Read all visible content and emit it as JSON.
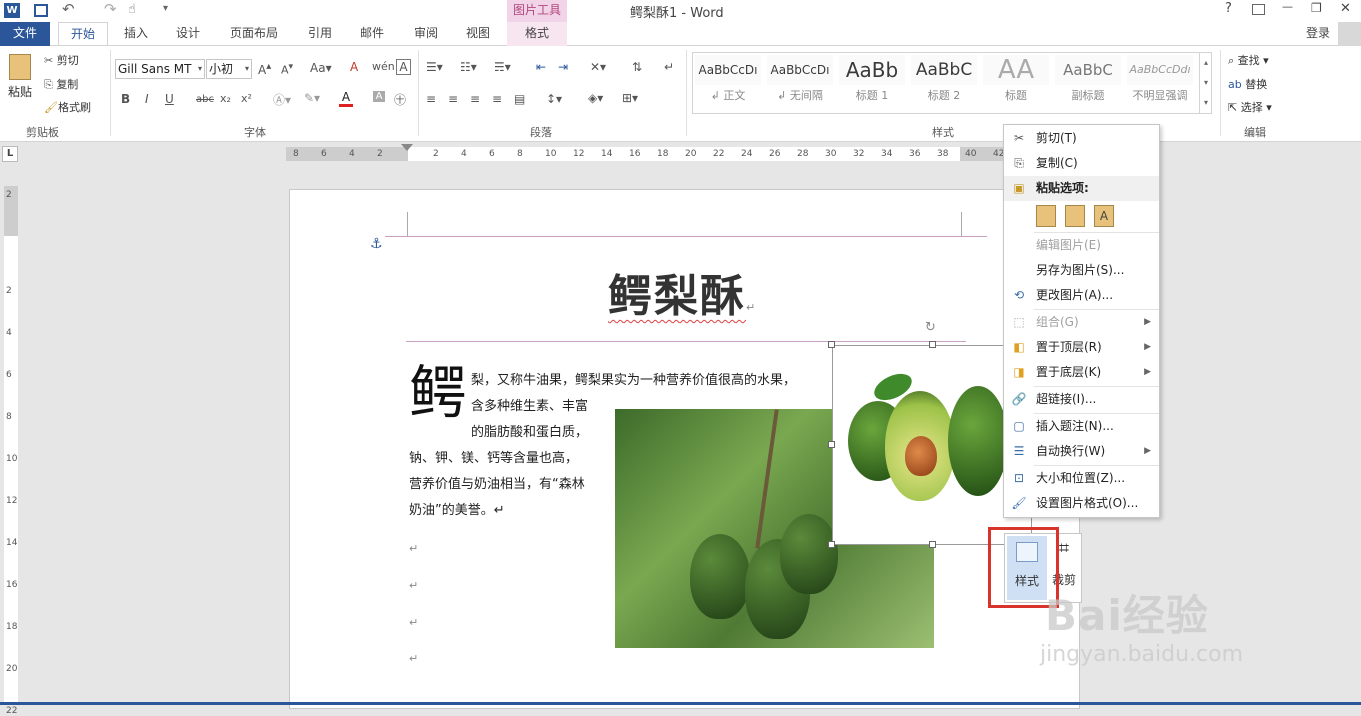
{
  "titlebar": {
    "doc_title": "鳄梨酥1 - Word",
    "picture_tools": "图片工具",
    "help": "?",
    "minimize": "—",
    "restore": "❐",
    "close": "✕",
    "quick": {
      "undo": "↶",
      "redo": "↷"
    }
  },
  "tabs": {
    "file": "文件",
    "home": "开始",
    "insert": "插入",
    "design": "设计",
    "layout": "页面布局",
    "references": "引用",
    "mailings": "邮件",
    "review": "审阅",
    "view": "视图",
    "format": "格式",
    "login": "登录"
  },
  "clipboard": {
    "paste": "粘贴",
    "cut": "剪切",
    "copy": "复制",
    "painter": "格式刷",
    "group": "剪贴板"
  },
  "font": {
    "name": "Gill Sans MT",
    "size": "小初",
    "group": "字体",
    "bold": "B",
    "italic": "I",
    "underline": "U",
    "strike": "abc",
    "sub": "x₂",
    "sup": "x²"
  },
  "paragraph": {
    "group": "段落"
  },
  "styles": {
    "group": "样式",
    "items": [
      {
        "preview": "AaBbCcDı",
        "label": "↲ 正文"
      },
      {
        "preview": "AaBbCcDı",
        "label": "↲ 无间隔"
      },
      {
        "preview": "AaBb",
        "label": "标题 1"
      },
      {
        "preview": "AaBbC",
        "label": "标题 2"
      },
      {
        "preview": "AA",
        "label": "标题"
      },
      {
        "preview": "AaBbC",
        "label": "副标题"
      },
      {
        "preview": "AaBbCcDdı",
        "label": "不明显强调"
      }
    ]
  },
  "editing": {
    "find": "查找",
    "replace": "替换",
    "select": "选择",
    "group": "编辑"
  },
  "ruler": {
    "ticks": [
      "8",
      "6",
      "4",
      "2",
      "2",
      "4",
      "6",
      "8",
      "10",
      "12",
      "14",
      "16",
      "18",
      "20",
      "22",
      "24",
      "26",
      "28",
      "30",
      "32",
      "34",
      "36",
      "38",
      "40",
      "42"
    ],
    "v_ticks": [
      "2",
      "2",
      "4",
      "6",
      "8",
      "10",
      "12",
      "14",
      "16",
      "18",
      "20",
      "22"
    ]
  },
  "document": {
    "title": "鳄梨酥",
    "dropcap": "鳄",
    "lines": [
      "梨，又称牛油果，鳄梨果实为一种营养价值很高的水果，",
      "含多种维生素、丰富",
      "的脂肪酸和蛋白质，",
      "钠、钾、镁、钙等含量也高，",
      "营养价值与奶油相当，有“森林",
      "奶油”的美誉。↵"
    ],
    "para_mark": "↵"
  },
  "context_menu": {
    "cut": "剪切(T)",
    "copy": "复制(C)",
    "paste_options": "粘贴选项:",
    "edit_picture": "编辑图片(E)",
    "save_as": "另存为图片(S)...",
    "change": "更改图片(A)...",
    "group": "组合(G)",
    "bring_front": "置于顶层(R)",
    "send_back": "置于底层(K)",
    "hyperlink": "超链接(I)...",
    "caption": "插入题注(N)...",
    "wrap": "自动换行(W)",
    "size_pos": "大小和位置(Z)...",
    "format": "设置图片格式(O)..."
  },
  "mini_toolbar": {
    "style": "样式",
    "crop": "裁剪"
  },
  "watermark": {
    "brand": "Bai经验",
    "url": "jingyan.baidu.com"
  },
  "colors": {
    "file_tab": "#2b579a",
    "picture_tools": "#f2d4e8",
    "accent": "#2b579a",
    "highlight_box": "#d9342b"
  }
}
